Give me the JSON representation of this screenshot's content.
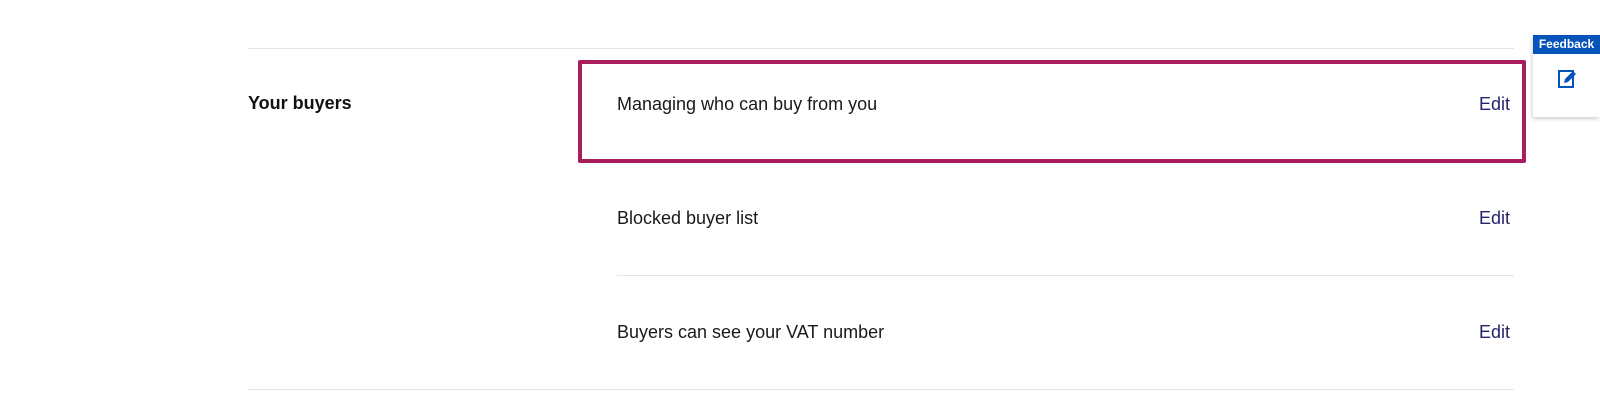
{
  "section": {
    "title": "Your buyers",
    "rows": [
      {
        "label": "Managing who can buy from you",
        "action": "Edit"
      },
      {
        "label": "Blocked buyer list",
        "action": "Edit"
      },
      {
        "label": "Buyers can see your VAT number",
        "action": "Edit"
      }
    ]
  },
  "feedback": {
    "label": "Feedback",
    "icon": "edit-note-icon"
  },
  "colors": {
    "highlight": "#a81d5c",
    "link": "#23246b",
    "feedback_bg": "#0654ba"
  }
}
